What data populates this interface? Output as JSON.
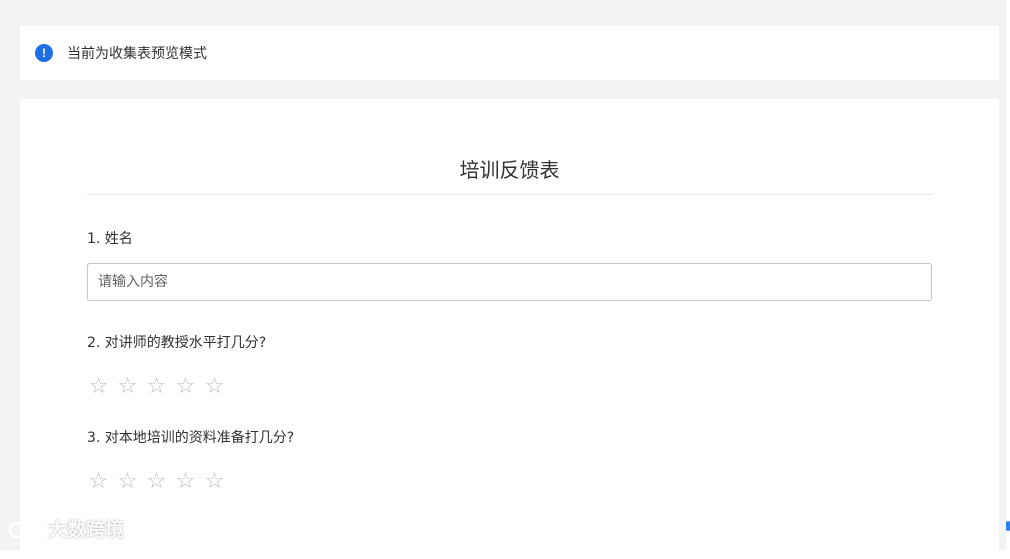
{
  "notice": {
    "icon": "info-exclamation-icon",
    "text": "当前为收集表预览模式",
    "accent": "#1e6fe8"
  },
  "form": {
    "title": "培训反馈表",
    "questions": [
      {
        "label": "1. 姓名",
        "type": "text",
        "placeholder": "请输入内容"
      },
      {
        "label": "2. 对讲师的教授水平打几分?",
        "type": "rating",
        "stars": 5,
        "value": 0
      },
      {
        "label": "3. 对本地培训的资料准备打几分?",
        "type": "rating",
        "stars": 5,
        "value": 0
      }
    ]
  },
  "watermark": {
    "text": "大数跨境"
  },
  "colors": {
    "page_bg": "#f2f3f5",
    "card_bg": "#ffffff",
    "star_empty": "#b8bcc4"
  }
}
